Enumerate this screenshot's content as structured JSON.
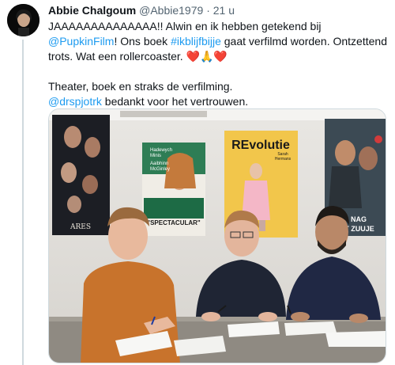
{
  "tweet": {
    "display_name": "Abbie Chalgoum",
    "handle": "@Abbie1979",
    "separator": "·",
    "time": "21 u",
    "line1_text": "JAAAAAAAAAAAAAA!! Alwin en ik hebben getekend bij ",
    "mention1": "@PupkinFilm",
    "line1_tail": "! Ons",
    "line2_start": "boek ",
    "hashtag": "#ikblijfbijje",
    "line2_tail": " gaat verfilmd worden. Ontzettend trots. Wat een",
    "line3_text": "rollercoaster. ",
    "emoji": "❤️🙏❤️",
    "line4_text": "Theater, boek en straks de verfilming.",
    "mention2": "@drspjotrk",
    "line5_tail": " bedankt voor het vertrouwen."
  },
  "media": {
    "posters": {
      "poster1_text": "ARES",
      "poster2_name1": "Hadewych",
      "poster2_name2": "Minis",
      "poster2_name3": "Aaibhinn",
      "poster2_name4": "McGinley",
      "poster2_title": "\"SPECTACULAR\"",
      "poster3_title": "REvolutie",
      "poster3_sub": "Sarah",
      "poster3_sub2": "Hermans",
      "poster4_title": "NAG",
      "poster4_title2": "'T ZUUJE"
    }
  },
  "colors": {
    "link": "#1d9bf0",
    "muted": "#536471",
    "heart": "#e0245e"
  }
}
